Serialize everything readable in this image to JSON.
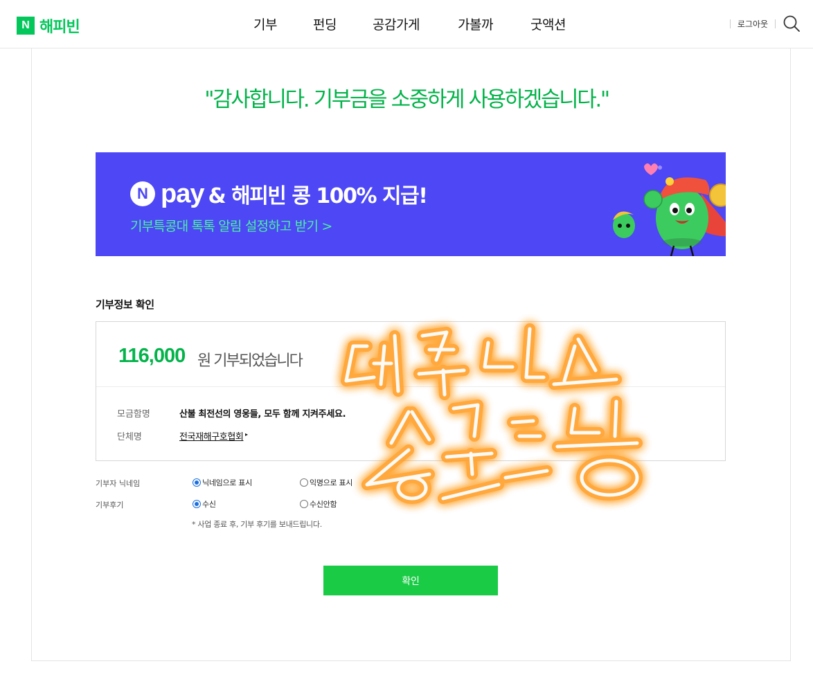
{
  "header": {
    "logo_mark": "N",
    "logo_text": "해피빈",
    "nav": [
      "기부",
      "펀딩",
      "공감가게",
      "가볼까",
      "굿액션"
    ],
    "logout_label": "로그아웃",
    "search_icon": "search-icon"
  },
  "main": {
    "thanks_message": "\"감사합니다. 기부금을 소중하게 사용하겠습니다.\"",
    "banner": {
      "n_mark": "N",
      "pay_text": "pay",
      "headline": "& 해피빈 콩 100% 지급!",
      "subtext": "기부특콩대 톡톡 알림 설정하고 받기 >",
      "background_color": "#4d47f5",
      "subtext_color": "#4af2a1"
    },
    "section_title": "기부정보 확인",
    "amount": "116,000",
    "amount_suffix": "원 기부되었습니다",
    "campaign_label": "모금함명",
    "campaign_value": "산불 최전선의 영웅들, 모두 함께 지켜주세요.",
    "org_label": "단체명",
    "org_value": "전국재해구호협회",
    "org_arrow": "▸",
    "nickname_label": "기부자 닉네임",
    "nickname_options": [
      "닉네임으로 표시",
      "익명으로 표시"
    ],
    "nickname_selected": 0,
    "review_label": "기부후기",
    "review_options": [
      "수신",
      "수신안함"
    ],
    "review_selected": 0,
    "review_note": "* 사업 종료 후, 기부 후기를 보내드립니다.",
    "confirm_label": "확인",
    "accent_green": "#03b34a",
    "button_green": "#19cb45"
  }
}
